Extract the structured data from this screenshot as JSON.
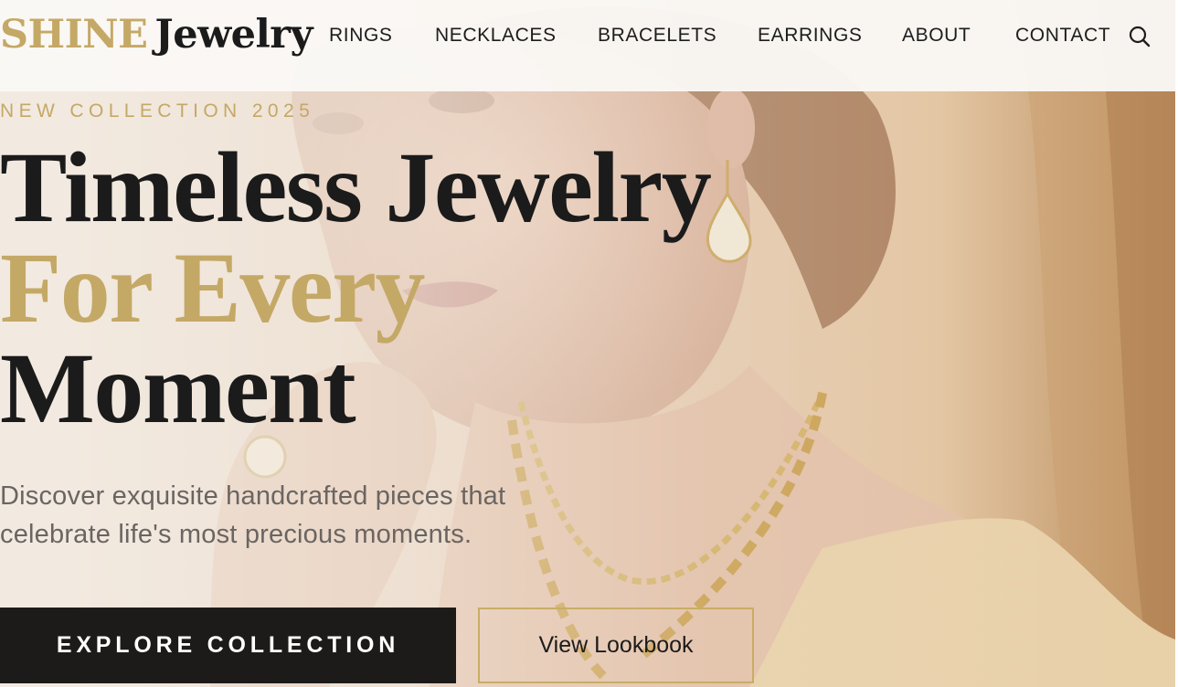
{
  "brand": {
    "logo_part1": "SHINE",
    "logo_part2": "Jewelry",
    "accent_color": "#c4a866",
    "ink_color": "#1b1b1b"
  },
  "nav": {
    "items": [
      {
        "label": "RINGS"
      },
      {
        "label": "NECKLACES"
      },
      {
        "label": "BRACELETS"
      },
      {
        "label": "EARRINGS"
      },
      {
        "label": "ABOUT"
      },
      {
        "label": "CONTACT"
      }
    ],
    "search_icon": "search-icon"
  },
  "hero": {
    "eyebrow": "NEW COLLECTION 2025",
    "headline_line1": "Timeless Jewelry",
    "headline_line2": "For Every",
    "headline_line3": "Moment",
    "subtitle": "Discover exquisite handcrafted pieces that celebrate life's most precious moments.",
    "primary_cta": "EXPLORE COLLECTION",
    "secondary_cta": "View Lookbook"
  }
}
